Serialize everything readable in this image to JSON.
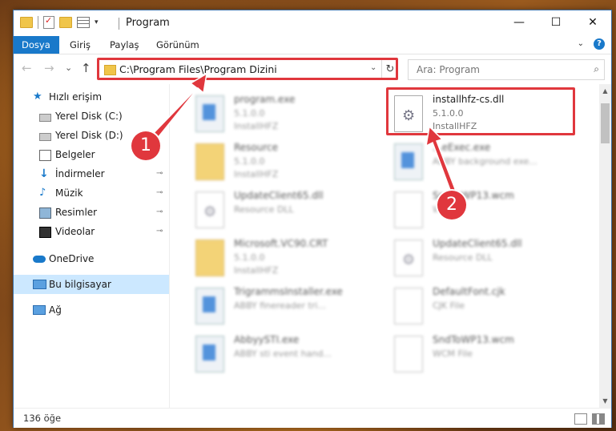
{
  "titlebar": {
    "title": "Program",
    "minimize": "—",
    "maximize": "☐",
    "close": "✕"
  },
  "ribbon": {
    "tabs": [
      {
        "label": "Dosya",
        "active": true
      },
      {
        "label": "Giriş"
      },
      {
        "label": "Paylaş"
      },
      {
        "label": "Görünüm"
      }
    ],
    "help": "?"
  },
  "navbar": {
    "back": "←",
    "forward": "→",
    "recent": "⌄",
    "up": "↑",
    "address": "C:\\Program Files\\Program Dizini",
    "dropdown": "⌄",
    "refresh": "↻",
    "search_placeholder": "Ara: Program",
    "search_icon": "⌕"
  },
  "sidebar": {
    "items": [
      {
        "label": "Hızlı erişim",
        "icon": "star-icon"
      },
      {
        "label": "Yerel Disk (C:)",
        "icon": "drive-icon"
      },
      {
        "label": "Yerel Disk (D:)",
        "icon": "drive-icon"
      },
      {
        "label": "Belgeler",
        "icon": "documents-icon"
      },
      {
        "label": "İndirmeler",
        "icon": "download-icon",
        "pinned": true
      },
      {
        "label": "Müzik",
        "icon": "music-icon",
        "pinned": true
      },
      {
        "label": "Resimler",
        "icon": "pictures-icon",
        "pinned": true
      },
      {
        "label": "Videolar",
        "icon": "videos-icon",
        "pinned": true
      },
      {
        "label": "OneDrive",
        "icon": "cloud-icon"
      },
      {
        "label": "Bu bilgisayar",
        "icon": "computer-icon",
        "selected": true
      },
      {
        "label": "Ağ",
        "icon": "network-icon"
      }
    ],
    "pin_glyph": "📌"
  },
  "files": [
    {
      "name": "program.exe",
      "sub1": "5.1.0.0",
      "sub2": "InstallHFZ",
      "type": "exe",
      "blurred": true
    },
    {
      "name": "installhfz-cs.dll",
      "sub1": "5.1.0.0",
      "sub2": "InstallHFZ",
      "type": "dll",
      "blurred": false
    },
    {
      "name": "Resource",
      "sub1": "5.1.0.0",
      "sub2": "InstallHFZ",
      "type": "folder",
      "blurred": true
    },
    {
      "name": "...eExec.exe",
      "sub1": "ABBY background exe...",
      "sub2": "",
      "type": "exe",
      "blurred": true
    },
    {
      "name": "UpdateClient65.dll",
      "sub1": "Resource DLL",
      "sub2": "",
      "type": "dll",
      "blurred": true
    },
    {
      "name": "SndToWP13.wcm",
      "sub1": "W...",
      "sub2": "",
      "type": "doc",
      "blurred": true
    },
    {
      "name": "Microsoft.VC90.CRT",
      "sub1": "5.1.0.0",
      "sub2": "InstallHFZ",
      "type": "folder",
      "blurred": true
    },
    {
      "name": "UpdateClient65.dll",
      "sub1": "Resource DLL",
      "sub2": "",
      "type": "dll",
      "blurred": true
    },
    {
      "name": "TrigrammsInstaller.exe",
      "sub1": "ABBY finereader tri...",
      "sub2": "",
      "type": "exe",
      "blurred": true
    },
    {
      "name": "DefaultFont.cjk",
      "sub1": "CJK File",
      "sub2": "",
      "type": "doc",
      "blurred": true
    },
    {
      "name": "AbbyySTI.exe",
      "sub1": "ABBY sti event hand...",
      "sub2": "",
      "type": "exe",
      "blurred": true
    },
    {
      "name": "SndToWP13.wcm",
      "sub1": "WCM File",
      "sub2": "",
      "type": "doc",
      "blurred": true
    }
  ],
  "annotations": {
    "badge1": "1",
    "badge2": "2",
    "highlight_color": "#e0373d"
  },
  "status": {
    "count": "136 öğe"
  }
}
